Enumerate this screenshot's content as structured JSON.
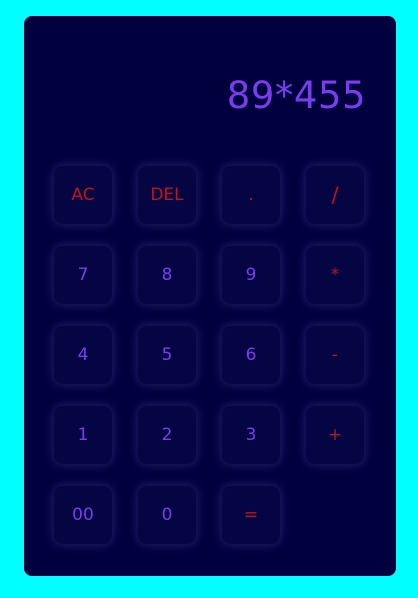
{
  "display": {
    "expression": "89*455"
  },
  "keys": {
    "ac": "AC",
    "del": "DEL",
    "dot": ".",
    "divide": "/",
    "seven": "7",
    "eight": "8",
    "nine": "9",
    "multiply": "*",
    "four": "4",
    "five": "5",
    "six": "6",
    "minus": "-",
    "one": "1",
    "two": "2",
    "three": "3",
    "plus": "+",
    "double_zero": "00",
    "zero": "0",
    "equals": "="
  },
  "colors": {
    "page_background": "#00ffff",
    "calculator_background": "#00003f",
    "key_background": "#050544",
    "number_text": "#7b3cf0",
    "operator_text": "#c0141a"
  }
}
